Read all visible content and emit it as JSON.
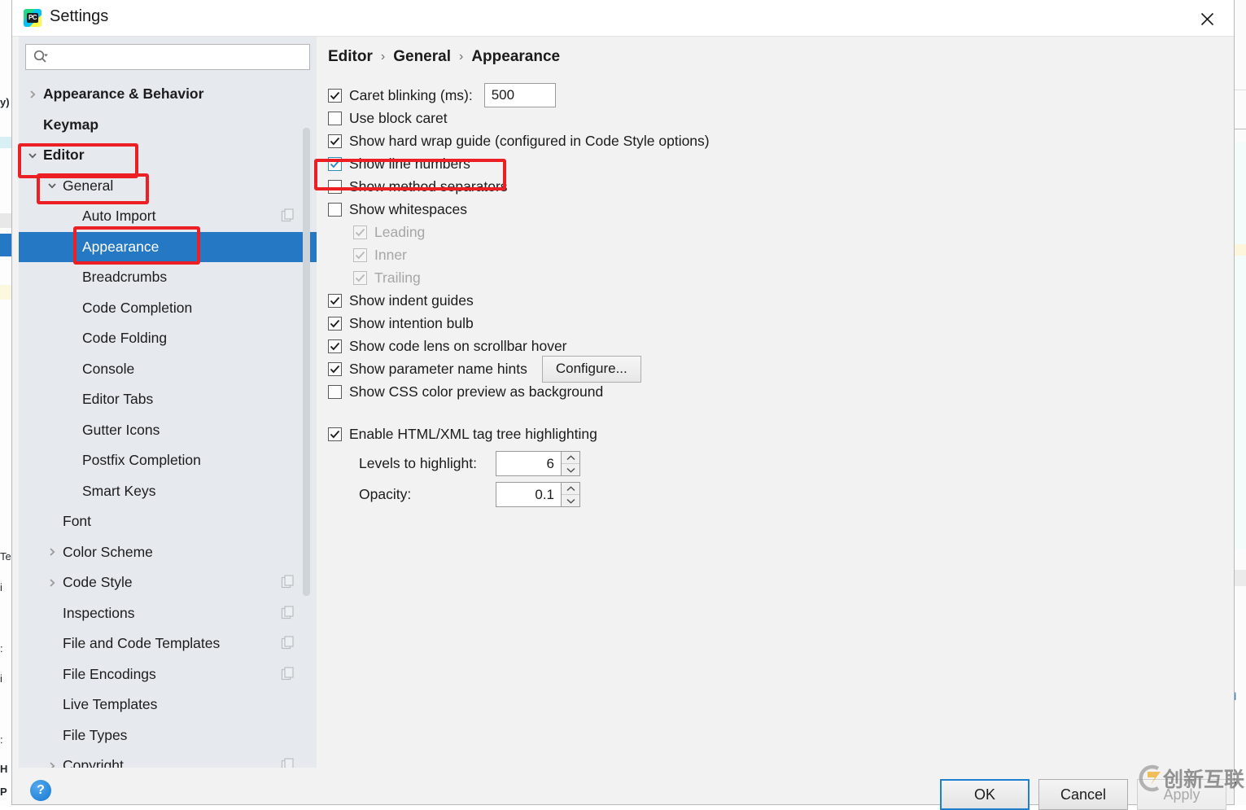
{
  "window": {
    "title": "Settings",
    "app_icon": "pycharm-icon",
    "close_icon": "close-icon"
  },
  "search": {
    "value": "",
    "placeholder": "",
    "icon": "search-icon"
  },
  "sidebar": {
    "scrollbar": "vertical-scrollbar",
    "items": [
      {
        "label": "Appearance & Behavior",
        "indent": 0,
        "arrow": "chevron-right",
        "bold": true,
        "selected": false,
        "copy_icon": false
      },
      {
        "label": "Keymap",
        "indent": 0,
        "arrow": "none",
        "bold": true,
        "selected": false,
        "copy_icon": false
      },
      {
        "label": "Editor",
        "indent": 0,
        "arrow": "chevron-down",
        "bold": true,
        "selected": false,
        "copy_icon": false
      },
      {
        "label": "General",
        "indent": 1,
        "arrow": "chevron-down",
        "bold": false,
        "selected": false,
        "copy_icon": false
      },
      {
        "label": "Auto Import",
        "indent": 2,
        "arrow": "none",
        "bold": false,
        "selected": false,
        "copy_icon": true
      },
      {
        "label": "Appearance",
        "indent": 2,
        "arrow": "none",
        "bold": false,
        "selected": true,
        "copy_icon": false
      },
      {
        "label": "Breadcrumbs",
        "indent": 2,
        "arrow": "none",
        "bold": false,
        "selected": false,
        "copy_icon": false
      },
      {
        "label": "Code Completion",
        "indent": 2,
        "arrow": "none",
        "bold": false,
        "selected": false,
        "copy_icon": false
      },
      {
        "label": "Code Folding",
        "indent": 2,
        "arrow": "none",
        "bold": false,
        "selected": false,
        "copy_icon": false
      },
      {
        "label": "Console",
        "indent": 2,
        "arrow": "none",
        "bold": false,
        "selected": false,
        "copy_icon": false
      },
      {
        "label": "Editor Tabs",
        "indent": 2,
        "arrow": "none",
        "bold": false,
        "selected": false,
        "copy_icon": false
      },
      {
        "label": "Gutter Icons",
        "indent": 2,
        "arrow": "none",
        "bold": false,
        "selected": false,
        "copy_icon": false
      },
      {
        "label": "Postfix Completion",
        "indent": 2,
        "arrow": "none",
        "bold": false,
        "selected": false,
        "copy_icon": false
      },
      {
        "label": "Smart Keys",
        "indent": 2,
        "arrow": "none",
        "bold": false,
        "selected": false,
        "copy_icon": false
      },
      {
        "label": "Font",
        "indent": 1,
        "arrow": "none",
        "bold": false,
        "selected": false,
        "copy_icon": false
      },
      {
        "label": "Color Scheme",
        "indent": 1,
        "arrow": "chevron-right",
        "bold": false,
        "selected": false,
        "copy_icon": false
      },
      {
        "label": "Code Style",
        "indent": 1,
        "arrow": "chevron-right",
        "bold": false,
        "selected": false,
        "copy_icon": true
      },
      {
        "label": "Inspections",
        "indent": 1,
        "arrow": "none",
        "bold": false,
        "selected": false,
        "copy_icon": true
      },
      {
        "label": "File and Code Templates",
        "indent": 1,
        "arrow": "none",
        "bold": false,
        "selected": false,
        "copy_icon": true
      },
      {
        "label": "File Encodings",
        "indent": 1,
        "arrow": "none",
        "bold": false,
        "selected": false,
        "copy_icon": true
      },
      {
        "label": "Live Templates",
        "indent": 1,
        "arrow": "none",
        "bold": false,
        "selected": false,
        "copy_icon": false
      },
      {
        "label": "File Types",
        "indent": 1,
        "arrow": "none",
        "bold": false,
        "selected": false,
        "copy_icon": false
      },
      {
        "label": "Copyright",
        "indent": 1,
        "arrow": "chevron-right",
        "bold": false,
        "selected": false,
        "copy_icon": true
      }
    ]
  },
  "breadcrumb": {
    "parts": [
      "Editor",
      "General",
      "Appearance"
    ],
    "separator": "›"
  },
  "options": {
    "caret_blinking": {
      "label": "Caret blinking (ms):",
      "checked": true,
      "value": "500"
    },
    "rows": [
      {
        "label": "Use block caret",
        "checked": false,
        "disabled": false,
        "indent": 0
      },
      {
        "label": "Show hard wrap guide (configured in Code Style options)",
        "checked": true,
        "disabled": false,
        "indent": 0
      },
      {
        "label": "Show line numbers",
        "checked": true,
        "disabled": false,
        "indent": 0,
        "focused": true
      },
      {
        "label": "Show method separators",
        "checked": false,
        "disabled": false,
        "indent": 0
      },
      {
        "label": "Show whitespaces",
        "checked": false,
        "disabled": false,
        "indent": 0
      },
      {
        "label": "Leading",
        "checked": true,
        "disabled": true,
        "indent": 1
      },
      {
        "label": "Inner",
        "checked": true,
        "disabled": true,
        "indent": 1
      },
      {
        "label": "Trailing",
        "checked": true,
        "disabled": true,
        "indent": 1
      },
      {
        "label": "Show indent guides",
        "checked": true,
        "disabled": false,
        "indent": 0
      },
      {
        "label": "Show intention bulb",
        "checked": true,
        "disabled": false,
        "indent": 0
      },
      {
        "label": "Show code lens on scrollbar hover",
        "checked": true,
        "disabled": false,
        "indent": 0
      }
    ],
    "parameter_hints": {
      "label": "Show parameter name hints",
      "checked": true,
      "button": "Configure..."
    },
    "css_preview": {
      "label": "Show CSS color preview as background",
      "checked": false
    },
    "tag_tree": {
      "label": "Enable HTML/XML tag tree highlighting",
      "checked": true,
      "levels_label": "Levels to highlight:",
      "levels_value": "6",
      "opacity_label": "Opacity:",
      "opacity_value": "0.1"
    }
  },
  "footer": {
    "help_icon": "help-icon",
    "ok": "OK",
    "cancel": "Cancel",
    "apply": "Apply"
  },
  "watermark": {
    "text": "创新互联",
    "logo": "cx-logo-icon"
  },
  "colors": {
    "selection": "#2478c4",
    "annotation": "#ec2024",
    "sidebar_bg": "#e6eaee",
    "panel_bg": "#f2f2f2",
    "focus_blue": "#2080d0"
  }
}
